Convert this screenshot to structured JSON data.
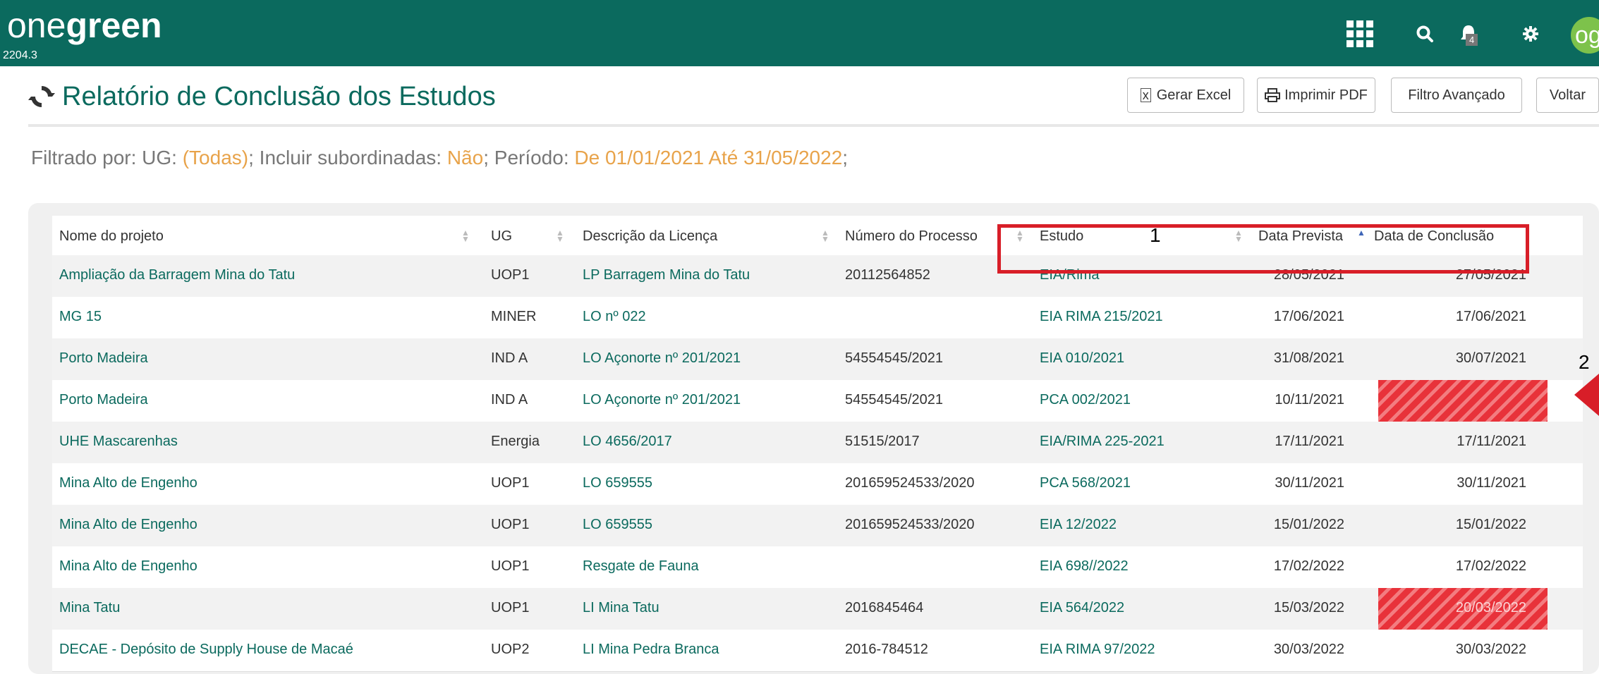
{
  "header": {
    "logo_light": "one",
    "logo_bold": "green",
    "version": "2204.3",
    "notifications_count": "4",
    "avatar_initials": "og",
    "icons": [
      "apps-grid-icon",
      "search-icon",
      "bell-icon",
      "gear-icon"
    ]
  },
  "page": {
    "title": "Relatório de Conclusão dos Estudos",
    "buttons": {
      "excel": "Gerar Excel",
      "pdf": "Imprimir PDF",
      "filter": "Filtro Avançado",
      "back": "Voltar"
    }
  },
  "filter": {
    "prefix": "Filtrado por: UG: ",
    "ug": "(Todas)",
    "sep1": "; Incluir subordinadas: ",
    "subordinadas": "Não",
    "sep2": "; Período: ",
    "periodo": "De 01/01/2021 Até 31/05/2022",
    "suffix": ";"
  },
  "table": {
    "columns": [
      "Nome do projeto",
      "UG",
      "Descrição da Licença",
      "Número do Processo",
      "Estudo",
      "Data Prevista",
      "Data de Conclusão"
    ],
    "rows": [
      [
        "Ampliação da Barragem Mina do Tatu",
        "UOP1",
        "LP Barragem Mina do Tatu",
        "20112564852",
        "EIA/Rima",
        "28/05/2021",
        "27/05/2021"
      ],
      [
        "MG 15",
        "MINER",
        "LO nº 022",
        "",
        "EIA RIMA 215/2021",
        "17/06/2021",
        "17/06/2021"
      ],
      [
        "Porto Madeira",
        "IND A",
        "LO Açonorte nº 201/2021",
        "54554545/2021",
        "EIA 010/2021",
        "31/08/2021",
        "30/07/2021"
      ],
      [
        "Porto Madeira",
        "IND A",
        "LO Açonorte nº 201/2021",
        "54554545/2021",
        "PCA 002/2021",
        "10/11/2021",
        ""
      ],
      [
        "UHE Mascarenhas",
        "Energia",
        "LO 4656/2017",
        "51515/2017",
        "EIA/RIMA 225-2021",
        "17/11/2021",
        "17/11/2021"
      ],
      [
        "Mina Alto de Engenho",
        "UOP1",
        "LO 659555",
        "201659524533/2020",
        "PCA 568/2021",
        "30/11/2021",
        "30/11/2021"
      ],
      [
        "Mina Alto de Engenho",
        "UOP1",
        "LO 659555",
        "201659524533/2020",
        "EIA 12/2022",
        "15/01/2022",
        "15/01/2022"
      ],
      [
        "Mina Alto de Engenho",
        "UOP1",
        "Resgate de Fauna",
        "",
        "EIA 698//2022",
        "17/02/2022",
        "17/02/2022"
      ],
      [
        "Mina Tatu",
        "UOP1",
        "LI Mina Tatu",
        "2016845464",
        "EIA 564/2022",
        "15/03/2022",
        "20/03/2022"
      ],
      [
        "DECAE - Depósito de Supply House de Macaé",
        "UOP2",
        "LI Mina Pedra Branca",
        "2016-784512",
        "EIA RIMA 97/2022",
        "30/03/2022",
        "30/03/2022"
      ]
    ],
    "highlighted_rows": [
      3,
      8
    ]
  },
  "annotations": {
    "box_label": "1",
    "arrow_label": "2",
    "box_color": "#d81e28"
  },
  "colors": {
    "brand": "#0b6a5e",
    "filter_value": "#e8a34a",
    "hatch": "#e8323a"
  }
}
